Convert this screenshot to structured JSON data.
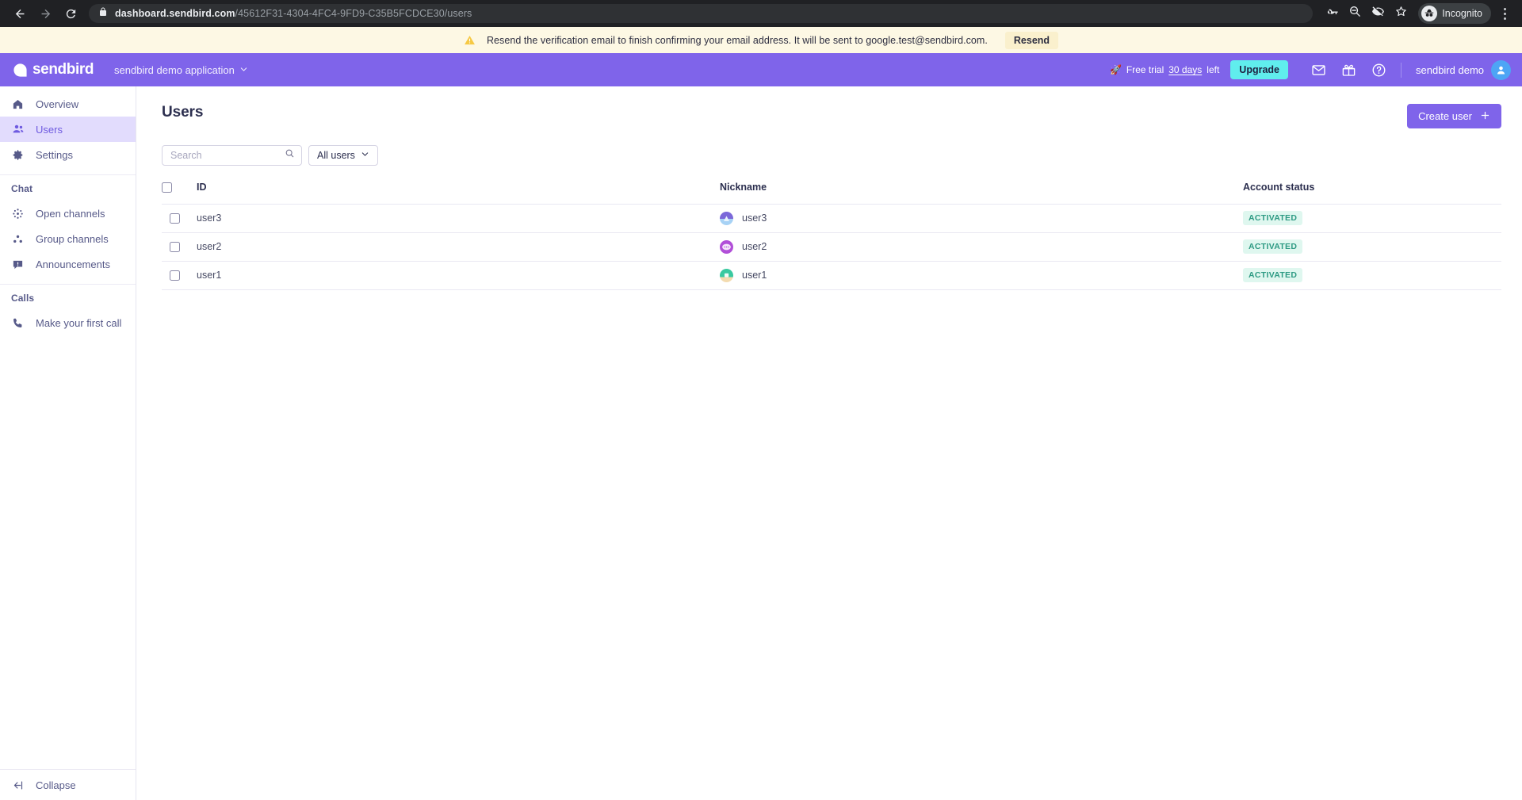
{
  "browser": {
    "back_icon": "back-arrow-icon",
    "forward_icon": "forward-arrow-icon",
    "reload_icon": "reload-icon",
    "lock_icon": "lock-icon",
    "url_bold": "dashboard.sendbird.com",
    "url_rest": "/45612F31-4304-4FC4-9FD9-C35B5FCDCE30/users",
    "icons": [
      "password-key-icon",
      "zoom-out-icon",
      "eye-slash-icon",
      "bookmark-star-icon"
    ],
    "profile_label": "Incognito",
    "menu_icon": "kebab-menu-icon"
  },
  "notice": {
    "warning_icon": "warning-triangle-icon",
    "message": "Resend the verification email to finish confirming your email address. It will be sent to google.test@sendbird.com.",
    "resend_label": "Resend",
    "background": "#fdf8e4"
  },
  "header": {
    "brand": "sendbird",
    "app_name": "sendbird demo application",
    "chevron_icon": "chevron-down-icon",
    "trial_emoji": "🚀",
    "trial_prefix": "Free trial",
    "trial_days": "30 days",
    "trial_suffix": "left",
    "upgrade_label": "Upgrade",
    "upgrade_color": "#60eded",
    "icons": [
      "envelope-icon",
      "gift-icon",
      "help-circle-icon"
    ],
    "user_name": "sendbird demo",
    "avatar_icon": "person-icon",
    "background": "#7f64ea"
  },
  "sidebar": {
    "items": [
      {
        "label": "Overview",
        "icon": "home-icon",
        "active": false
      },
      {
        "label": "Users",
        "icon": "users-icon",
        "active": true
      },
      {
        "label": "Settings",
        "icon": "gear-icon",
        "active": false
      }
    ],
    "chat_section": "Chat",
    "chat_items": [
      {
        "label": "Open channels",
        "icon": "open-channels-icon"
      },
      {
        "label": "Group channels",
        "icon": "group-channels-icon"
      },
      {
        "label": "Announcements",
        "icon": "announcement-icon"
      }
    ],
    "calls_section": "Calls",
    "calls_items": [
      {
        "label": "Make your first call",
        "icon": "phone-icon"
      }
    ],
    "collapse_label": "Collapse",
    "collapse_icon": "collapse-arrow-icon",
    "active_background": "#e2dcfd"
  },
  "main": {
    "title": "Users",
    "create_button": "Create user",
    "create_icon": "plus-icon",
    "search": {
      "value": "",
      "placeholder": "Search",
      "icon": "search-icon"
    },
    "filter": {
      "label": "All users",
      "icon": "chevron-down-icon"
    },
    "table": {
      "columns": [
        "ID",
        "Nickname",
        "Account status"
      ],
      "rows": [
        {
          "id": "user3",
          "nickname": "user3",
          "status": "ACTIVATED",
          "avatar_color": "#7b68d9",
          "avatar_color2": "#a7d2f5"
        },
        {
          "id": "user2",
          "nickname": "user2",
          "status": "ACTIVATED",
          "avatar_color": "#b14fd8",
          "avatar_color2": "#8b3fc9"
        },
        {
          "id": "user1",
          "nickname": "user1",
          "status": "ACTIVATED",
          "avatar_color": "#3ac9a0",
          "avatar_color2": "#f3dbb0"
        }
      ],
      "status_bg": "#dff7ef",
      "status_fg": "#2d9a83"
    }
  }
}
